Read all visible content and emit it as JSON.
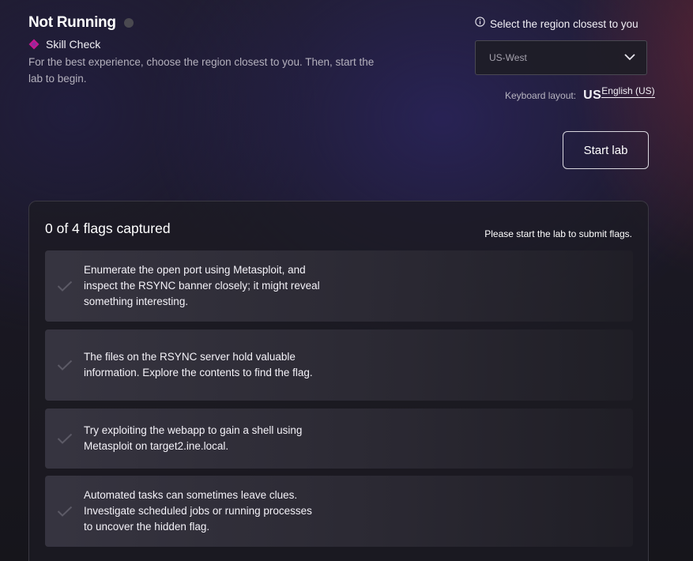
{
  "header": {
    "status": "Not Running",
    "badge": "Skill Check",
    "intro": "For the best experience, choose the region closest to you. Then, start the lab to begin."
  },
  "region": {
    "label": "Select the region closest to you",
    "selected": "US-West"
  },
  "keyboard": {
    "label": "Keyboard layout:",
    "code": "US",
    "name": "English (US)"
  },
  "start_button": "Start lab",
  "flags": {
    "count_text": "0 of 4 flags captured",
    "note": "Please start the lab to submit flags.",
    "items": [
      {
        "text": "Enumerate the open port using Metasploit, and inspect the RSYNC banner closely; it might reveal something interesting."
      },
      {
        "text": "The files on the RSYNC server hold valuable information. Explore the contents to find the flag."
      },
      {
        "text": "Try exploiting the webapp to gain a shell using Metasploit on target2.ine.local."
      },
      {
        "text": "Automated tasks can sometimes leave clues. Investigate scheduled jobs or running processes to uncover the hidden flag."
      }
    ]
  },
  "colors": {
    "status_dot": "#4a4950",
    "badge_accent": "#c2188e",
    "check_mark": "#5c5a66"
  },
  "icons": {
    "badge": "diamond-badge-icon",
    "info": "info-icon",
    "dropdown": "chevron-down-icon",
    "flag_check": "check-icon"
  }
}
